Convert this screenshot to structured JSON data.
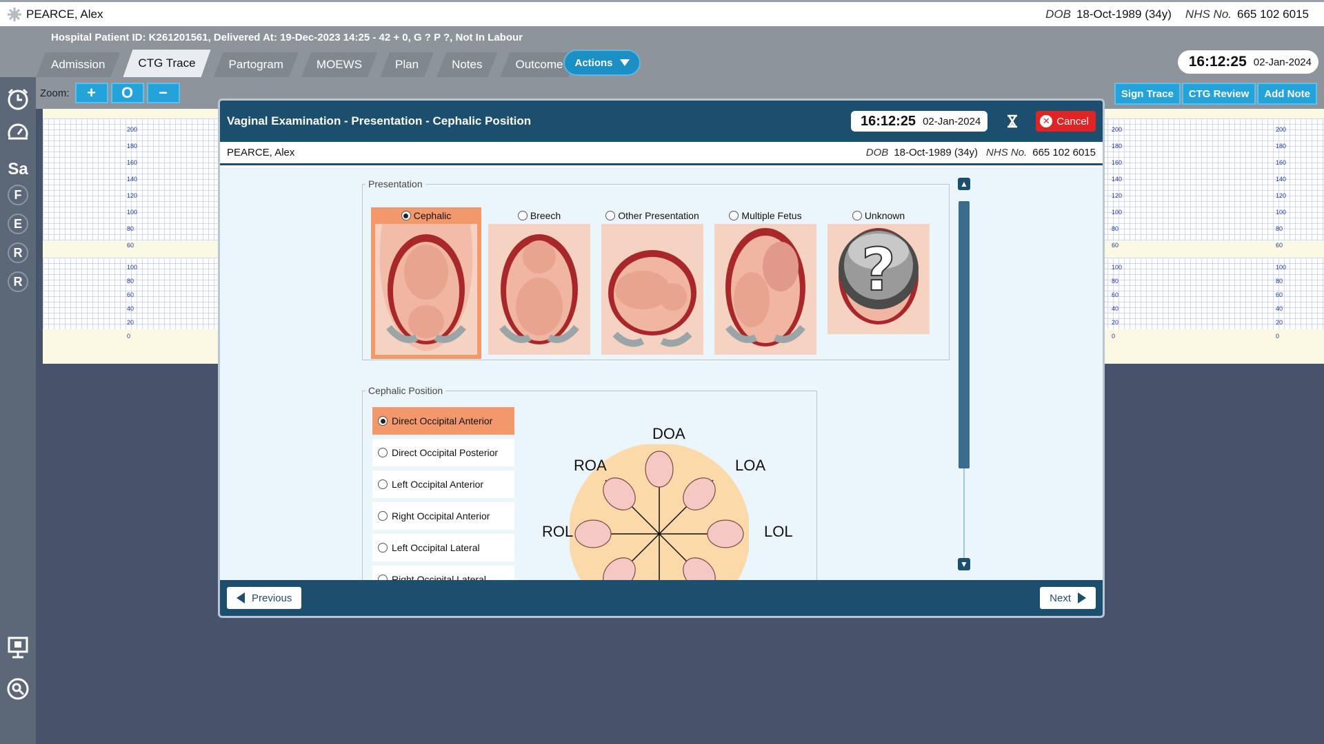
{
  "patient": {
    "name": "PEARCE, Alex",
    "dob_label": "DOB",
    "dob": "18-Oct-1989 (34y)",
    "nhs_label": "NHS No.",
    "nhs": "665 102 6015"
  },
  "header": {
    "info": "Hospital Patient ID: K261201561, Delivered At: 19-Dec-2023 14:25 - 42 + 0, G ? P ?,   Not In Labour",
    "tabs": [
      "Admission",
      "CTG Trace",
      "Partogram",
      "MOEWS",
      "Plan",
      "Notes",
      "Outcome"
    ],
    "active_tab": "CTG Trace",
    "actions_label": "Actions",
    "time": "16:12:25",
    "date": "02-Jan-2024"
  },
  "rail": {
    "letters": [
      "Sa",
      "F",
      "E",
      "R",
      "R"
    ]
  },
  "toolbar": {
    "zoom_label": "Zoom:",
    "zoom_buttons": [
      "+",
      "O",
      "−"
    ],
    "right_buttons": [
      "Sign Trace",
      "CTG Review",
      "Add Note"
    ]
  },
  "ctg": {
    "fhr_scale": [
      "200",
      "180",
      "160",
      "140",
      "120",
      "100",
      "80",
      "60"
    ],
    "toco_scale": [
      "100",
      "80",
      "60",
      "40",
      "20",
      "0"
    ]
  },
  "modal": {
    "title": "Vaginal Examination - Presentation - Cephalic Position",
    "time": "16:12:25",
    "date": "02-Jan-2024",
    "cancel_label": "Cancel",
    "presentation_legend": "Presentation",
    "presentations": [
      {
        "label": "Cephalic",
        "selected": true
      },
      {
        "label": "Breech",
        "selected": false
      },
      {
        "label": "Other Presentation",
        "selected": false
      },
      {
        "label": "Multiple Fetus",
        "selected": false
      },
      {
        "label": "Unknown",
        "selected": false
      }
    ],
    "position_legend": "Cephalic Position",
    "positions": [
      {
        "label": "Direct Occipital Anterior",
        "selected": true
      },
      {
        "label": "Direct Occipital Posterior",
        "selected": false
      },
      {
        "label": "Left Occipital Anterior",
        "selected": false
      },
      {
        "label": "Right Occipital Anterior",
        "selected": false
      },
      {
        "label": "Left Occipital Lateral",
        "selected": false
      },
      {
        "label": "Right Occipital Lateral",
        "selected": false
      }
    ],
    "diagram_labels": {
      "doa": "DOA",
      "roa": "ROA",
      "loa": "LOA",
      "rol": "ROL",
      "lol": "LOL"
    },
    "prev_label": "Previous",
    "next_label": "Next"
  },
  "colors": {
    "header_blue": "#1c4e6e",
    "accent_blue": "#23a3da",
    "selected_orange": "#f3986a",
    "cancel_red": "#e02424"
  }
}
